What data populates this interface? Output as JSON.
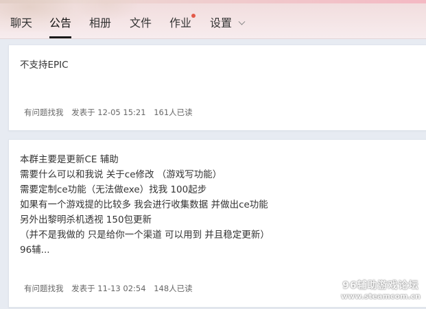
{
  "tabs": [
    {
      "label": "聊天"
    },
    {
      "label": "公告"
    },
    {
      "label": "相册"
    },
    {
      "label": "文件"
    },
    {
      "label": "作业"
    },
    {
      "label": "设置"
    }
  ],
  "active_tab": "公告",
  "notices": [
    {
      "lines": [
        "不支持EPIC"
      ],
      "author": "有问题找我",
      "posted": "发表于 12-05 15:21",
      "reads": "161人已读"
    },
    {
      "lines": [
        "本群主要是更新CE 辅助",
        "需要什么可以和我说 关于ce修改 （游戏写功能）",
        "需要定制ce功能（无法做exe）找我 100起步",
        "如果有一个游戏提的比较多 我会进行收集数据 并做出ce功能",
        "另外出黎明杀机透视 150包更新",
        "（并不是我做的 只是给你一个渠道 可以用到 并且稳定更新）",
        "96辅..."
      ],
      "author": "有问题找我",
      "posted": "发表于 11-13 02:54",
      "reads": "148人已读"
    }
  ],
  "watermark": {
    "line1": "96辅助游戏论坛",
    "line2": "www.steamcom.cn"
  },
  "colors": {
    "header_bg": "#f4e3e4",
    "active_underline": "#1a1a1a",
    "notification_dot": "#e25a4a",
    "page_bg": "#e7ebf2"
  }
}
